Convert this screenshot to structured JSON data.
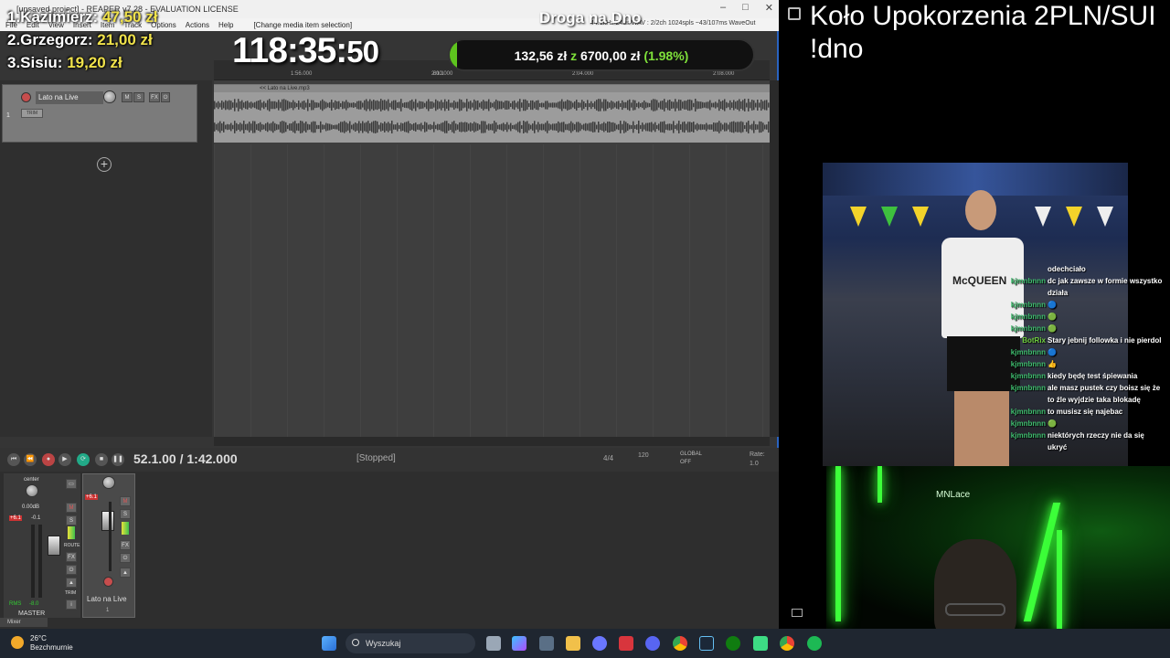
{
  "reaper": {
    "title": "[unsaved project] - REAPER v7.28 - EVALUATION LICENSE",
    "status": "44.1kHz 24bit WAV : 2/2ch 1024spls ~43/107ms WaveOut",
    "window_buttons": [
      "–",
      "□",
      "✕"
    ],
    "menu": [
      "File",
      "Edit",
      "View",
      "Insert",
      "Item",
      "Track",
      "Options",
      "Actions",
      "Help"
    ],
    "menu_hint": "[Change media item selection]",
    "ruler_ticks": [
      "61.1",
      "1:56.000",
      "2:00.000",
      "2:04.000",
      "2:08.000"
    ],
    "track": {
      "name": "Lato na Live",
      "number": "1",
      "item_label": "<< Lato na Live.mp3",
      "trim": "TRIM"
    },
    "transport": {
      "position": "52.1.00 / 1:42.000",
      "state": "[Stopped]",
      "time_sig": "4/4",
      "bpm": "120",
      "global_label": "GLOBAL",
      "global_value": "OFF",
      "rate_label": "Rate:",
      "rate_value": "1.0"
    },
    "mixer": {
      "master_pan": "center",
      "master_db": "0.00dB",
      "master_peak": "+6.1",
      "master_peak2": "-0.1",
      "rms_label": "RMS",
      "rms_value": "-8.0",
      "master_label": "MASTER",
      "route_label": "ROUTE",
      "trim_label": "TRIM",
      "track_peak": "+6.1",
      "track_label": "Lato na Live",
      "track_number": "1",
      "mixer_tab": "Mixer"
    }
  },
  "overlay": {
    "leaderboard": [
      {
        "rank_name": "1.Kazimierz:",
        "amount": "47,50 zł"
      },
      {
        "rank_name": "2.Grzegorz:",
        "amount": "21,00 zł"
      },
      {
        "rank_name": "3.Sisiu:",
        "amount": "19,20 zł"
      }
    ],
    "timer_main": "118:35:",
    "timer_seconds": "50",
    "stream_title": "Droga na Dno",
    "goal": {
      "current": "132,56 zł",
      "connector": "z",
      "target": "6700,00 zł",
      "percent_text": "(1.98%)",
      "fraction": 0.0198,
      "color": "#5ec41e"
    }
  },
  "right": {
    "marquee_line1": "Koło Upokorzenia 2PLN/SUI",
    "marquee_line2": "!dno",
    "chat": [
      {
        "user": "",
        "msg": "odechciało"
      },
      {
        "user": "kjmnbnnn",
        "msg": "dc jak zawsze w formie wszystko działa"
      },
      {
        "user": "kjmnbnnn",
        "msg": "🔵"
      },
      {
        "user": "kjmnbnnn",
        "msg": "🟢"
      },
      {
        "user": "kjmnbnnn",
        "msg": "🟢"
      },
      {
        "user": "BotRix",
        "msg": "Stary jebnij followka i nie pierdol",
        "bot": true
      },
      {
        "user": "kjmnbnnn",
        "msg": "🔵"
      },
      {
        "user": "kjmnbnnn",
        "msg": "👍"
      },
      {
        "user": "kjmnbnnn",
        "msg": "kiedy będę test śpiewania"
      },
      {
        "user": "kjmnbnnn",
        "msg": "ale masz pustek czy boisz się że to źle wyjdzie taka blokadę"
      },
      {
        "user": "kjmnbnnn",
        "msg": "to musisz się najebac"
      },
      {
        "user": "kjmnbnnn",
        "msg": "🟢"
      },
      {
        "user": "kjmnbnnn",
        "msg": "niektórych rzeczy nie da się ukryć"
      }
    ],
    "shirt_text": "McQUEEN",
    "cam_label": "MNLace"
  },
  "taskbar": {
    "temp": "26°C",
    "weather": "Bezchmurnie",
    "search_placeholder": "Wyszukaj",
    "start_color": "#3a8ee6"
  }
}
